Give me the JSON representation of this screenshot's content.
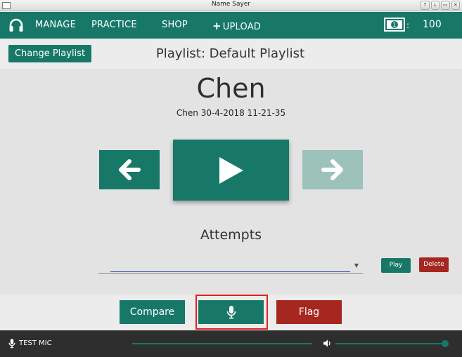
{
  "window": {
    "title": "Name Sayer",
    "controls": [
      "↑",
      "↓",
      "▭",
      "✕"
    ]
  },
  "nav": {
    "items": [
      "MANAGE",
      "PRACTICE",
      "SHOP",
      "UPLOAD"
    ],
    "upload_plus": "+",
    "money_icon": "banknote-icon",
    "money_symbol": "1",
    "money_colon": ":",
    "money_value": "100"
  },
  "header": {
    "change_playlist_label": "Change Playlist",
    "playlist_title": "Playlist: Default Playlist"
  },
  "practice": {
    "name": "Chen",
    "recording": "Chen 30-4-2018 11-21-35"
  },
  "attempts": {
    "title": "Attempts",
    "selected": "",
    "play_label": "Play",
    "delete_label": "Delete"
  },
  "actions": {
    "compare_label": "Compare",
    "flag_label": "Flag",
    "record_icon": "microphone-icon"
  },
  "bottom": {
    "test_mic_label": "TEST MIC",
    "volume_level": 1.0
  },
  "colors": {
    "primary": "#177868",
    "primary_disabled": "#9cc2ba",
    "danger": "#a5271f",
    "highlight": "#e02020",
    "bottom_bar": "#2e2e2e"
  }
}
